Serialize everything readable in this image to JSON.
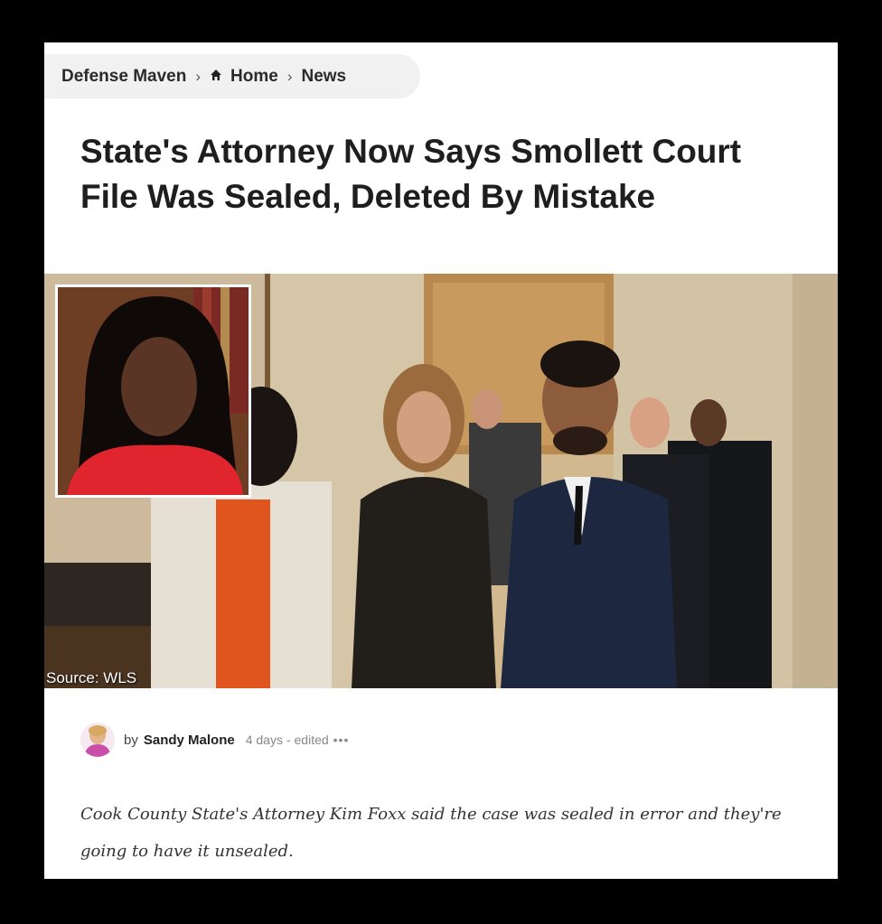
{
  "breadcrumb": {
    "site": "Defense Maven",
    "home": "Home",
    "section": "News",
    "home_icon": "home-icon",
    "separator_icon": "chevron-right-icon"
  },
  "article": {
    "title": "State's Attorney Now Says Smollett Court File Was Sealed, Deleted By Mistake",
    "image_credit": "Source: WLS",
    "byline": {
      "prefix": "by",
      "author": "Sandy Malone",
      "time": "4 days",
      "edited": "- edited",
      "more": "•••"
    },
    "lede": "Cook County State's Attorney Kim Foxx said the case was sealed in error and they're going to have it unsealed."
  },
  "colors": {
    "page_bg": "#ffffff",
    "frame_bg": "#000000",
    "breadcrumb_bg": "#f1f1f1",
    "title_text": "#1e1e1e"
  }
}
